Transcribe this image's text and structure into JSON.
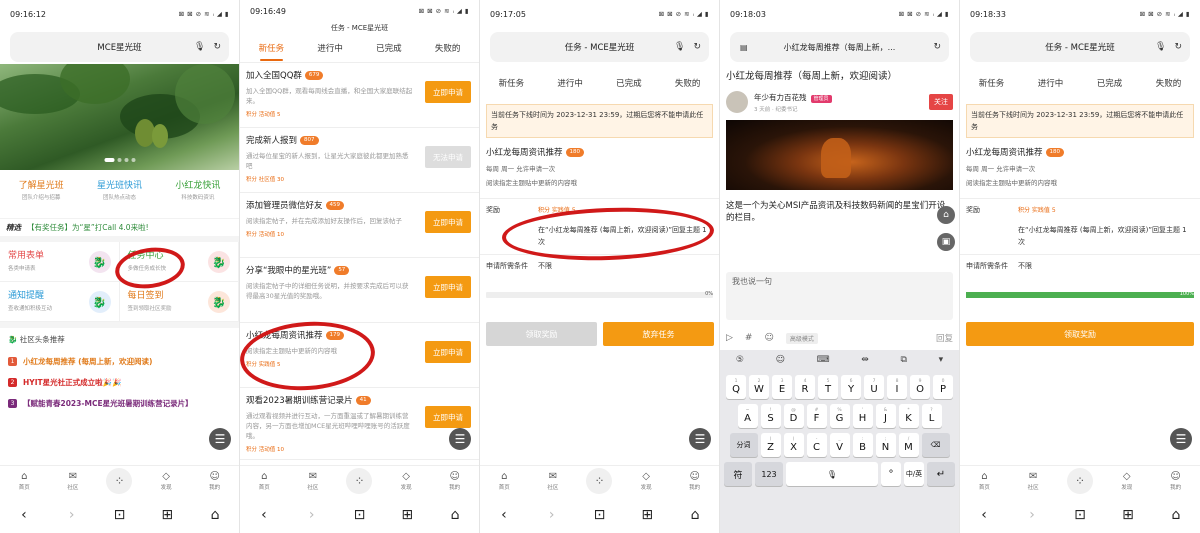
{
  "status_times": [
    "09:16:12",
    "09:16:49",
    "09:17:05",
    "09:18:03",
    "09:18:33"
  ],
  "status_icons": "⊠ ⊠ ⊘ ≋ ᵢ ◢ ▮",
  "nav": {
    "items": [
      "首页",
      "社区",
      "",
      "发现",
      "我的"
    ],
    "sys": [
      "‹",
      "›",
      "⊡",
      "⊞",
      "⌂"
    ]
  },
  "p1": {
    "addr_title": "MCE星光班",
    "quick": [
      {
        "title": "了解星光班",
        "sub": "团队介绍与招募",
        "color": "#e07a1a"
      },
      {
        "title": "星光班快讯",
        "sub": "团队热点动态",
        "color": "#2a9ad6"
      },
      {
        "title": "小红龙快讯",
        "sub": "科技数码资讯",
        "color": "#3aa13a"
      }
    ],
    "ann_key": "精选",
    "ann_text": "【有奖任务】为“星”打Call 4.0来啦!",
    "grid": [
      {
        "title": "常用表单",
        "sub": "各类申请表",
        "color": "#e44b4b"
      },
      {
        "title": "任务中心",
        "sub": "多做任务成长快",
        "color": "#3aa13a"
      },
      {
        "title": "通知提醒",
        "sub": "查收通知积极互动",
        "color": "#2a9ad6"
      },
      {
        "title": "每日签到",
        "sub": "签到领取社区奖励",
        "color": "#e07a1a"
      }
    ],
    "rec_header": "社区头条推荐",
    "rec": [
      {
        "n": "1",
        "text": "小红龙每周推荐 (每周上新，欢迎阅读)",
        "color": "#e07a1a"
      },
      {
        "n": "2",
        "text": "HYIT星光社正式成立啦🎉🎉",
        "color": "#d42a2a"
      },
      {
        "n": "3",
        "text": "【赋能青春2023-MCE星光班暑期训练营记录片】",
        "color": "#7a2a7a"
      }
    ]
  },
  "p2": {
    "title": "任务 - MCE星光班",
    "tabs": [
      "新任务",
      "进行中",
      "已完成",
      "失败的"
    ],
    "tasks": [
      {
        "title": "加入全国QQ群",
        "badge": "679",
        "desc": "加入全国QQ群，观看每周线会直播，和全国大家庭联结起来。",
        "pts": "积分 活动值 5",
        "btn": "立即申请",
        "disabled": false
      },
      {
        "title": "完成新人报到",
        "badge": "807",
        "desc": "通过每位星宝的新人报到，让星光大家庭彼此都更加熟悉吧",
        "pts": "积分 社区值 30",
        "btn": "无法申请",
        "disabled": true
      },
      {
        "title": "添加管理员微信好友",
        "badge": "459",
        "desc": "阅读指定帖子，并在完成添加好友操作后，回复该帖子",
        "pts": "积分 活动值 10",
        "btn": "立即申请",
        "disabled": false
      },
      {
        "title": "分享“我眼中的星光班”",
        "badge": "57",
        "desc": "阅读指定帖子中的详细任务说明，并按要求完成后可以获得最高30星光值的奖励哦。",
        "pts": "",
        "btn": "立即申请",
        "disabled": false
      },
      {
        "title": "小红龙每周资讯推荐",
        "badge": "179",
        "desc": "阅读指定主题贴中更新的内容哦",
        "pts": "积分 实践值 5",
        "btn": "立即申请",
        "disabled": false
      },
      {
        "title": "观看2023暑期训练营记录片",
        "badge": "41",
        "desc": "通过观看视频并进行互动，一方面重温或了解暑期训练营内容，另一方面也增加MCE星光班哔哩哔哩账号的活跃度哦。",
        "pts": "积分 活动值 10",
        "btn": "立即申请",
        "disabled": false
      }
    ]
  },
  "p3": {
    "title": "任务 - MCE星光班",
    "tabs": [
      "新任务",
      "进行中",
      "已完成",
      "失败的"
    ],
    "notice": "当前任务下线时间为 2023-12-31 23:59，过期后您将不能申请此任务",
    "task_title": "小红龙每周资讯推荐",
    "badge": "180",
    "freq": "每周 周一 允许申请一次",
    "desc": "阅读指定主题贴中更新的内容哦",
    "reward_k": "奖励",
    "reward_v": "积分 实践值 5",
    "req_v": "在“小红龙每周推荐 (每周上新，欢迎阅读)”回复主题 1 次",
    "cond_k": "申请所需条件",
    "cond_v": "不限",
    "progress": 0,
    "progress_label": "0%",
    "btn_left": "领取奖励",
    "btn_right": "放弃任务"
  },
  "p4": {
    "title": "小红龙每周推荐（每周上新，...",
    "article_title": "小红龙每周推荐（每周上新，欢迎阅读）",
    "author": "年少有力百花残",
    "author_tag": "管理员",
    "author_meta": "3 天前 · 纪委书记",
    "follow": "关注",
    "para": "这是一个为关心MSI产品资讯及科技数码新闻的星宝们开设的栏目。",
    "comment_placeholder": "我也说一句",
    "tool_mode": "高级模式",
    "send": "回复",
    "kb_tools": [
      "⑤",
      "☺",
      "⌨",
      "⇹",
      "⧉",
      "▾"
    ],
    "row1": [
      [
        "Q",
        "1"
      ],
      [
        "W",
        "2"
      ],
      [
        "E",
        "3"
      ],
      [
        "R",
        "4"
      ],
      [
        "T",
        "5"
      ],
      [
        "Y",
        "6"
      ],
      [
        "U",
        "7"
      ],
      [
        "I",
        "8"
      ],
      [
        "O",
        "9"
      ],
      [
        "P",
        "0"
      ]
    ],
    "row2": [
      [
        "A",
        "~"
      ],
      [
        "S",
        "!"
      ],
      [
        "D",
        "@"
      ],
      [
        "F",
        "#"
      ],
      [
        "G",
        "%"
      ],
      [
        "H",
        "'"
      ],
      [
        "J",
        "&"
      ],
      [
        "K",
        "*"
      ],
      [
        "L",
        "?"
      ]
    ],
    "row3": [
      [
        "Z",
        "("
      ],
      [
        "X",
        ")"
      ],
      [
        "C",
        "-"
      ],
      [
        "V",
        "_"
      ],
      [
        "B",
        ":"
      ],
      [
        "N",
        ";"
      ],
      [
        "M",
        "/"
      ]
    ],
    "row3_left": "分词",
    "row4": [
      "符",
      "123",
      "",
      "⎵",
      "°",
      "中/英",
      "↵"
    ]
  },
  "p5": {
    "title": "任务 - MCE星光班",
    "tabs": [
      "新任务",
      "进行中",
      "已完成",
      "失败的"
    ],
    "notice": "当前任务下线时间为 2023-12-31 23:59，过期后您将不能申请此任务",
    "task_title": "小红龙每周资讯推荐",
    "badge": "180",
    "freq": "每周 周一 允许申请一次",
    "desc": "阅读指定主题贴中更新的内容哦",
    "reward_k": "奖励",
    "reward_v": "积分 实践值 5",
    "req_v": "在“小红龙每周推荐 (每周上新，欢迎阅读)”回复主题 1 次",
    "cond_k": "申请所需条件",
    "cond_v": "不限",
    "progress": 100,
    "progress_label": "100%",
    "btn": "领取奖励"
  },
  "colors": {
    "accent": "#f49a12",
    "tab_active": "#e9690f",
    "annotation": "#d01919",
    "progress": "#4caf50"
  }
}
